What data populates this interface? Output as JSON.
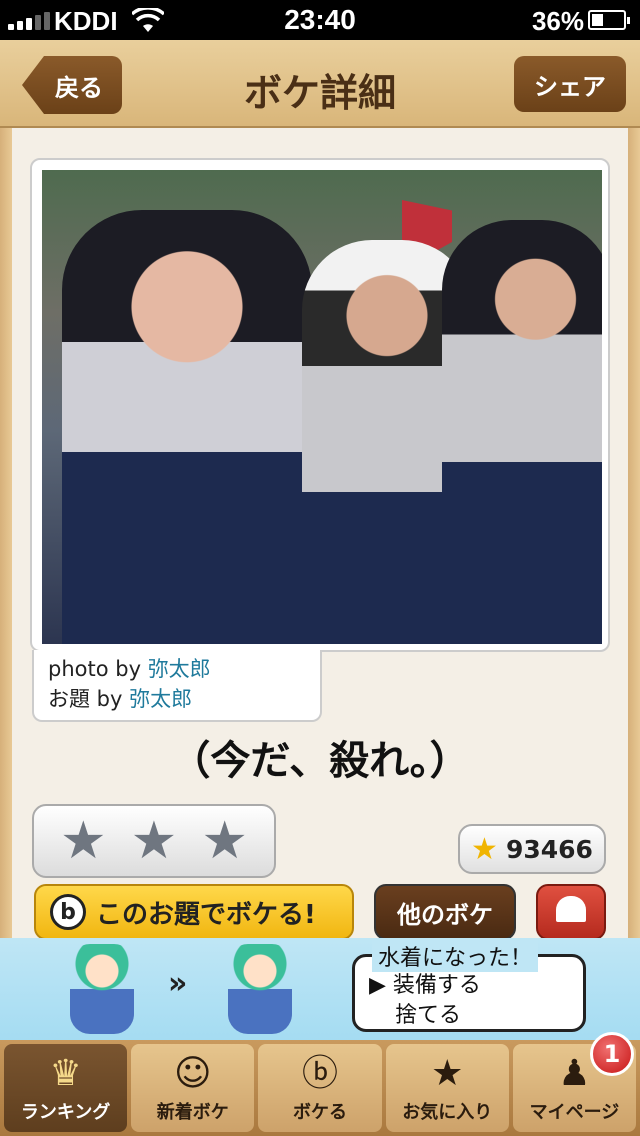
{
  "status_bar": {
    "carrier": "KDDI",
    "time": "23:40",
    "battery_percent": "36%",
    "battery_level": 0.36
  },
  "nav": {
    "back_label": "戻る",
    "title": "ボケ詳細",
    "share_label": "シェア"
  },
  "photo": {
    "credit_photo_prefix": "photo by ",
    "credit_photo_user": "弥太郎",
    "credit_topic_prefix": "お題 by ",
    "credit_topic_user": "弥太郎"
  },
  "boke": {
    "text": "（今だ、殺れ。）"
  },
  "rating": {
    "stars": [
      "★",
      "★",
      "★"
    ],
    "score": "93466"
  },
  "actions": {
    "boke_now_label": "このお題でボケる!",
    "b_icon": "b",
    "other_boke_label": "他のボケ"
  },
  "ad": {
    "arrow": "»",
    "bubble_title": "水着になった！",
    "bubble_line1": "▶ 装備する",
    "bubble_line2": "捨てる"
  },
  "tabs": [
    {
      "label": "ランキング",
      "icon": "crown-icon",
      "glyph": "♛",
      "active": true
    },
    {
      "label": "新着ボケ",
      "icon": "face-icon",
      "glyph": "☺",
      "active": false
    },
    {
      "label": "ボケる",
      "icon": "b-logo-icon",
      "glyph": "ⓑ",
      "active": false
    },
    {
      "label": "お気に入り",
      "icon": "star-icon",
      "glyph": "★",
      "active": false
    },
    {
      "label": "マイページ",
      "icon": "person-icon",
      "glyph": "♟",
      "active": false
    }
  ],
  "mypage_badge": "1",
  "colors": {
    "wood": "#d9b67a",
    "nav_button": "#6b4118",
    "accent_yellow": "#f1b611",
    "link": "#1f7a9c"
  }
}
